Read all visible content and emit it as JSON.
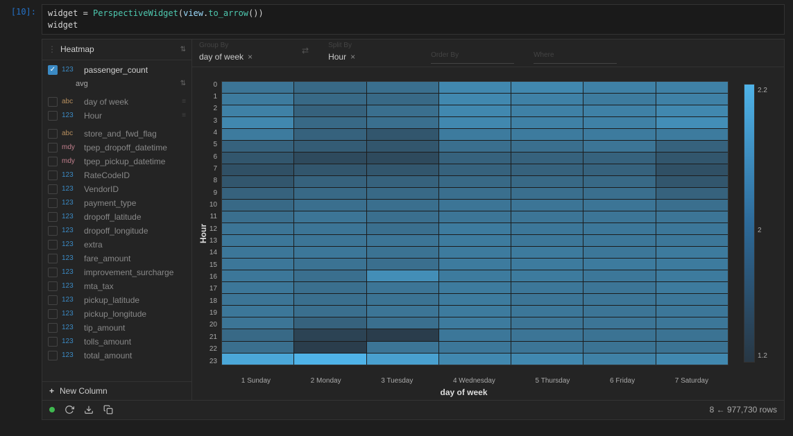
{
  "prompt": "[10]:",
  "code_line1_a": "widget = ",
  "code_line1_b": "PerspectiveWidget",
  "code_line1_c": "(",
  "code_line1_d": "view",
  "code_line1_e": ".",
  "code_line1_f": "to_arrow",
  "code_line1_g": "())",
  "code_line2": "widget",
  "view_type": "Heatmap",
  "active_column": {
    "type": "123",
    "name": "passenger_count",
    "agg": "avg"
  },
  "pivots": {
    "group_by_label": "Group By",
    "group_by": "day of week",
    "split_by_label": "Split By",
    "split_by": "Hour",
    "order_by_label": "Order By",
    "order_by": "",
    "where_label": "Where",
    "where": ""
  },
  "columns": [
    {
      "type": "abc",
      "name": "day of week",
      "used": true
    },
    {
      "type": "123",
      "name": "Hour",
      "used": true
    },
    {
      "type": "abc",
      "name": "store_and_fwd_flag",
      "used": false
    },
    {
      "type": "mdy",
      "name": "tpep_dropoff_datetime",
      "used": false
    },
    {
      "type": "mdy",
      "name": "tpep_pickup_datetime",
      "used": false
    },
    {
      "type": "123",
      "name": "RateCodeID",
      "used": false
    },
    {
      "type": "123",
      "name": "VendorID",
      "used": false
    },
    {
      "type": "123",
      "name": "payment_type",
      "used": false
    },
    {
      "type": "123",
      "name": "dropoff_latitude",
      "used": false
    },
    {
      "type": "123",
      "name": "dropoff_longitude",
      "used": false
    },
    {
      "type": "123",
      "name": "extra",
      "used": false
    },
    {
      "type": "123",
      "name": "fare_amount",
      "used": false
    },
    {
      "type": "123",
      "name": "improvement_surcharge",
      "used": false
    },
    {
      "type": "123",
      "name": "mta_tax",
      "used": false
    },
    {
      "type": "123",
      "name": "pickup_latitude",
      "used": false
    },
    {
      "type": "123",
      "name": "pickup_longitude",
      "used": false
    },
    {
      "type": "123",
      "name": "tip_amount",
      "used": false
    },
    {
      "type": "123",
      "name": "tolls_amount",
      "used": false
    },
    {
      "type": "123",
      "name": "total_amount",
      "used": false
    }
  ],
  "new_column_label": "New Column",
  "status": "8 ← 977,730 rows",
  "chart_data": {
    "type": "heatmap",
    "title": "",
    "xlabel": "day of week",
    "ylabel": "Hour",
    "x_categories": [
      "1 Sunday",
      "2 Monday",
      "3 Tuesday",
      "4 Wednesday",
      "5 Thursday",
      "6 Friday",
      "7 Saturday"
    ],
    "y_categories": [
      "0",
      "1",
      "2",
      "3",
      "4",
      "5",
      "6",
      "7",
      "8",
      "9",
      "10",
      "11",
      "12",
      "13",
      "14",
      "15",
      "16",
      "17",
      "18",
      "19",
      "20",
      "21",
      "22",
      "23"
    ],
    "legend": {
      "min": 1.2,
      "mid": 2.0,
      "max": 2.2
    },
    "values": [
      [
        1.7,
        1.6,
        1.65,
        1.85,
        1.85,
        1.8,
        1.8
      ],
      [
        1.75,
        1.6,
        1.6,
        1.85,
        1.8,
        1.75,
        1.8
      ],
      [
        1.8,
        1.55,
        1.65,
        1.85,
        1.8,
        1.8,
        1.85
      ],
      [
        1.85,
        1.6,
        1.65,
        1.85,
        1.8,
        1.8,
        1.9
      ],
      [
        1.75,
        1.55,
        1.45,
        1.75,
        1.75,
        1.75,
        1.75
      ],
      [
        1.55,
        1.5,
        1.45,
        1.65,
        1.65,
        1.7,
        1.55
      ],
      [
        1.45,
        1.35,
        1.35,
        1.55,
        1.55,
        1.55,
        1.45
      ],
      [
        1.4,
        1.45,
        1.45,
        1.55,
        1.55,
        1.55,
        1.4
      ],
      [
        1.45,
        1.55,
        1.55,
        1.6,
        1.6,
        1.6,
        1.45
      ],
      [
        1.55,
        1.6,
        1.6,
        1.65,
        1.65,
        1.65,
        1.55
      ],
      [
        1.6,
        1.65,
        1.65,
        1.7,
        1.7,
        1.7,
        1.65
      ],
      [
        1.65,
        1.7,
        1.65,
        1.7,
        1.7,
        1.7,
        1.7
      ],
      [
        1.7,
        1.7,
        1.65,
        1.75,
        1.72,
        1.72,
        1.72
      ],
      [
        1.72,
        1.7,
        1.7,
        1.75,
        1.72,
        1.72,
        1.72
      ],
      [
        1.72,
        1.72,
        1.68,
        1.75,
        1.75,
        1.72,
        1.75
      ],
      [
        1.72,
        1.68,
        1.65,
        1.75,
        1.75,
        1.75,
        1.75
      ],
      [
        1.72,
        1.65,
        1.9,
        1.75,
        1.75,
        1.72,
        1.75
      ],
      [
        1.72,
        1.65,
        1.7,
        1.75,
        1.72,
        1.7,
        1.75
      ],
      [
        1.7,
        1.65,
        1.68,
        1.75,
        1.7,
        1.7,
        1.72
      ],
      [
        1.72,
        1.65,
        1.7,
        1.75,
        1.72,
        1.7,
        1.72
      ],
      [
        1.7,
        1.55,
        1.65,
        1.75,
        1.7,
        1.7,
        1.72
      ],
      [
        1.6,
        1.3,
        1.25,
        1.72,
        1.7,
        1.68,
        1.68
      ],
      [
        1.65,
        1.25,
        1.7,
        1.72,
        1.7,
        1.68,
        1.68
      ],
      [
        2.1,
        2.2,
        2.05,
        1.85,
        1.85,
        1.8,
        1.85
      ]
    ]
  }
}
